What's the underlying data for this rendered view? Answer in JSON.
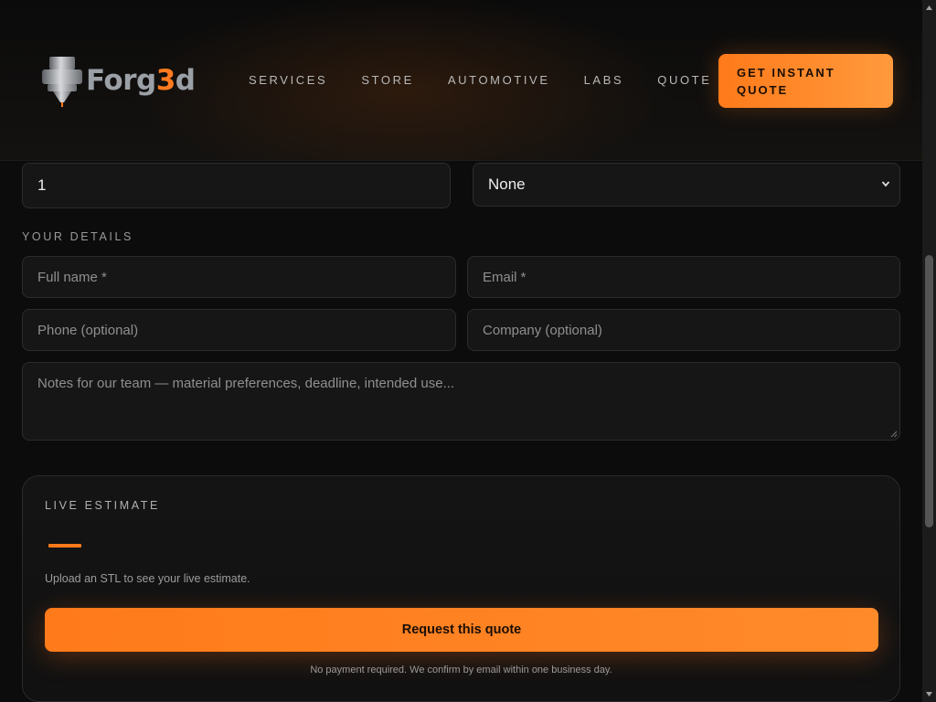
{
  "brand": {
    "name_prefix": "Forg",
    "name_accent": "3",
    "name_suffix": "d",
    "accent_color": "#ff7a1a"
  },
  "nav": {
    "items": [
      "SERVICES",
      "STORE",
      "AUTOMOTIVE",
      "LABS",
      "QUOTE"
    ],
    "cta_label": "GET INSTANT QUOTE"
  },
  "order": {
    "quantity_value": "1",
    "finish_selected": "None"
  },
  "details": {
    "section_label": "YOUR DETAILS",
    "full_name_placeholder": "Full name *",
    "email_placeholder": "Email *",
    "phone_placeholder": "Phone (optional)",
    "company_placeholder": "Company (optional)",
    "notes_placeholder": "Notes for our team — material preferences, deadline, intended use..."
  },
  "estimate": {
    "title": "LIVE ESTIMATE",
    "hint": "Upload an STL to see your live estimate.",
    "submit_label": "Request this quote",
    "note": "No payment required. We confirm by email within one business day."
  },
  "icons": {
    "logo": "nozzle-logo-icon",
    "select": "chevron-down-icon",
    "resize": "resize-grip-icon"
  }
}
